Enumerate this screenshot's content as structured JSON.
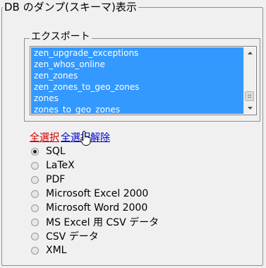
{
  "fieldset_title": "DB のダンプ(スキーマ)表示",
  "export": {
    "legend": "エクスポート",
    "tables": [
      "zen_upgrade_exceptions",
      "zen_whos_online",
      "zen_zones",
      "zen_zones_to_geo_zones",
      "zones",
      "zones_to_geo_zones"
    ],
    "select_all": "全選択",
    "deselect_all": "全選択解除"
  },
  "formats": [
    {
      "label": "SQL",
      "selected": true
    },
    {
      "label": "LaTeX",
      "selected": false
    },
    {
      "label": "PDF",
      "selected": false
    },
    {
      "label": "Microsoft Excel 2000",
      "selected": false
    },
    {
      "label": "Microsoft Word 2000",
      "selected": false
    },
    {
      "label": "MS Excel 用  CSV データ",
      "selected": false
    },
    {
      "label": "CSV データ",
      "selected": false
    },
    {
      "label": "XML",
      "selected": false
    }
  ],
  "colors": {
    "selection": "#3399ff",
    "select_all_link": "#cc0000",
    "deselect_all_link": "#0000cc"
  }
}
